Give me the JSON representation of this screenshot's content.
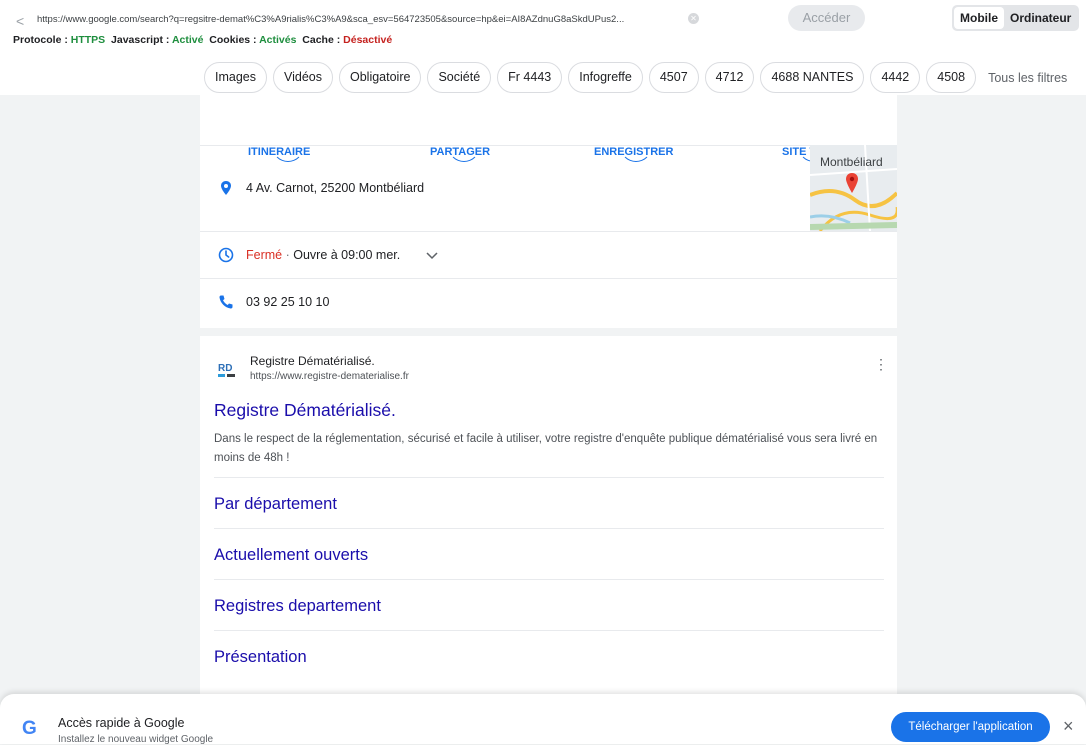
{
  "topbar": {
    "back": "<",
    "url": "https://www.google.com/search?q=regsitre-demat%C3%A9rialis%C3%A9&sca_esv=564723505&source=hp&ei=AI8AZdnuG8aSkdUPus2...",
    "go_label": "Accéder",
    "view_mobile": "Mobile",
    "view_desktop": "Ordinateur",
    "info": {
      "protocol_label": "Protocole :",
      "protocol_value": "HTTPS",
      "js_label": "Javascript :",
      "js_value": "Activé",
      "cookies_label": "Cookies :",
      "cookies_value": "Activés",
      "cache_label": "Cache :",
      "cache_value": "Désactivé"
    }
  },
  "chips": [
    "Images",
    "Vidéos",
    "Obligatoire",
    "Société",
    "Fr 4443",
    "Infogreffe",
    "4507",
    "4712",
    "4688 NANTES",
    "4442",
    "4508"
  ],
  "all_filters": "Tous les filtres",
  "local": {
    "actions": [
      "ITINERAIRE",
      "PARTAGER",
      "ENREGISTRER",
      "SITE WEB"
    ],
    "address": "4 Av. Carnot, 25200 Montbéliard",
    "map_label": "Montbéliard",
    "status_closed": "Fermé",
    "status_sep": " · ",
    "status_open": "Ouvre à 09:00 mer.",
    "phone": "03 92 25 10 10"
  },
  "result": {
    "logo": "RD",
    "site_name": "Registre Dématérialisé.",
    "site_url": "https://www.registre-dematerialise.fr",
    "title": "Registre Dématérialisé.",
    "snippet": "Dans le respect de la réglementation, sécurisé et facile à utiliser, votre registre d'enquête publique dématérialisé vous sera livré en moins de 48h !",
    "sitelinks": [
      "Par département",
      "Actuellement ouverts",
      "Registres departement",
      "Présentation"
    ]
  },
  "banner": {
    "logo": "G",
    "title": "Accès rapide à Google",
    "subtitle": "Installez le nouveau widget Google",
    "button": "Télécharger l'application",
    "close": "×"
  },
  "colors": {
    "accent": "#1a73e8",
    "link": "#1a0dab",
    "closed": "#d93025",
    "ok": "#1e8e3e"
  }
}
